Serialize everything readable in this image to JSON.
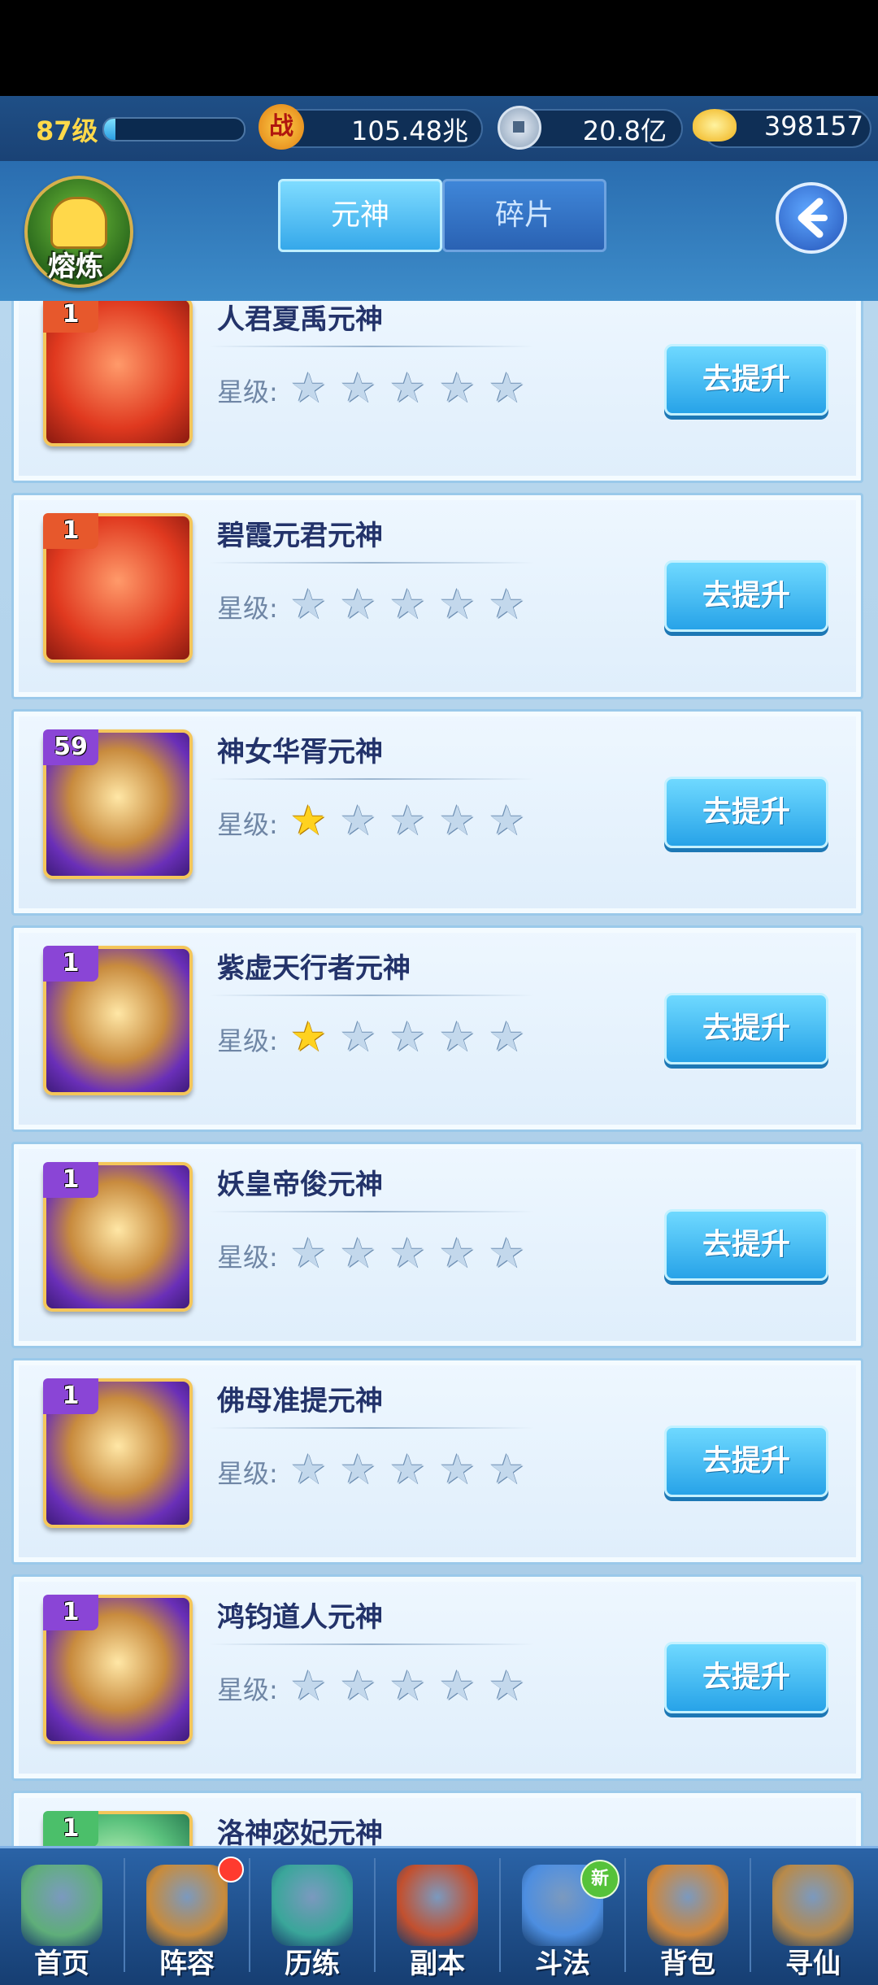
{
  "resources": {
    "level": "87级",
    "xp_progress": 0.08,
    "combat_icon": "战",
    "combat_power": "105.48兆",
    "coin_value": "20.8亿",
    "gold_value": "398157"
  },
  "header": {
    "melt_label": "熔炼",
    "tabs": [
      {
        "label": "元神",
        "active": true
      },
      {
        "label": "碎片",
        "active": false
      }
    ]
  },
  "list": {
    "star_label": "星级:",
    "button_label": "去提升",
    "items": [
      {
        "name": "人君夏禹元神",
        "badge": "1",
        "stars": 0,
        "rarity": "red"
      },
      {
        "name": "碧霞元君元神",
        "badge": "1",
        "stars": 0,
        "rarity": "red"
      },
      {
        "name": "神女华胥元神",
        "badge": "59",
        "stars": 1,
        "rarity": "purple"
      },
      {
        "name": "紫虚天行者元神",
        "badge": "1",
        "stars": 1,
        "rarity": "purple"
      },
      {
        "name": "妖皇帝俊元神",
        "badge": "1",
        "stars": 0,
        "rarity": "purple"
      },
      {
        "name": "佛母准提元神",
        "badge": "1",
        "stars": 0,
        "rarity": "purple"
      },
      {
        "name": "鸿钧道人元神",
        "badge": "1",
        "stars": 0,
        "rarity": "purple"
      },
      {
        "name": "洛神宓妃元神",
        "badge": "1",
        "stars": 0,
        "rarity": "green"
      }
    ]
  },
  "nav": {
    "items": [
      {
        "label": "首页",
        "icon": "home-icon",
        "color": "#5fae7a"
      },
      {
        "label": "阵容",
        "icon": "lineup-icon",
        "color": "#c98b3a",
        "dot": true
      },
      {
        "label": "历练",
        "icon": "training-icon",
        "color": "#3aa69a"
      },
      {
        "label": "副本",
        "icon": "dungeon-icon",
        "color": "#c2502f"
      },
      {
        "label": "斗法",
        "icon": "battle-icon",
        "color": "#4d8ee0",
        "new_label": "新"
      },
      {
        "label": "背包",
        "icon": "bag-icon",
        "color": "#d0873a"
      },
      {
        "label": "寻仙",
        "icon": "scroll-icon",
        "color": "#b88a4a"
      }
    ]
  }
}
